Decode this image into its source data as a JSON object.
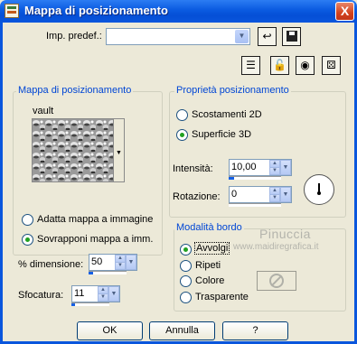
{
  "window": {
    "title": "Mappa di posizionamento",
    "close_glyph": "X"
  },
  "preset": {
    "label": "Imp. predef.:",
    "value": ""
  },
  "map_group": {
    "title": "Mappa di posizionamento",
    "map_name": "vault",
    "fit_label": "Adatta mappa a immagine",
    "tile_label": "Sovrapponi mappa a imm.",
    "selected": "tile",
    "size_label": "% dimensione:",
    "size_value": "50",
    "blur_label": "Sfocatura:",
    "blur_value": "11"
  },
  "props_group": {
    "title": "Proprietà posizionamento",
    "offset_label": "Scostamenti 2D",
    "surface_label": "Superficie 3D",
    "selected": "surface",
    "intensity_label": "Intensità:",
    "intensity_value": "10,00",
    "rotation_label": "Rotazione:",
    "rotation_value": "0"
  },
  "edge_group": {
    "title": "Modalità bordo",
    "wrap_label": "Avvolgi",
    "repeat_label": "Ripeti",
    "color_label": "Colore",
    "transparent_label": "Trasparente",
    "selected": "wrap"
  },
  "watermark": {
    "name": "Pinuccia",
    "url": "www.maidiregrafica.it"
  },
  "buttons": {
    "ok": "OK",
    "cancel": "Annulla",
    "help": "?"
  },
  "colors": {
    "title_bar": "#0a56dd",
    "dialog_bg": "#ece9d8",
    "group_title": "#0046d5",
    "accent": "#1560e5"
  }
}
